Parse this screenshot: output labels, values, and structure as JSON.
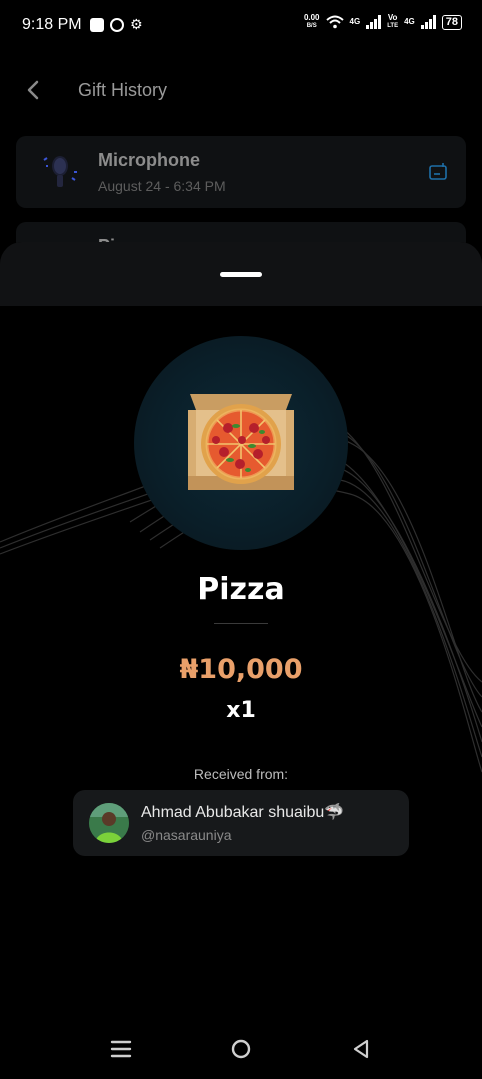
{
  "status_bar": {
    "time": "9:18 PM",
    "net_speed_value": "0.00",
    "net_speed_unit": "B/S",
    "network_1": "4G",
    "volte_top": "Vo",
    "volte_bottom": "LTE",
    "network_2": "4G",
    "battery": "78"
  },
  "header": {
    "title": "Gift History"
  },
  "gift_list": [
    {
      "name": "Microphone",
      "date": "August 24 - 6:34 PM"
    },
    {
      "name": "Pizza",
      "date": ""
    }
  ],
  "sheet": {
    "gift_name": "Pizza",
    "price": "₦10,000",
    "quantity": "x1",
    "received_label": "Received from:",
    "sender": {
      "name": "Ahmad Abubakar shuaibu🦈",
      "handle": "@nasarauniya"
    }
  },
  "colors": {
    "price": "#e9a06a",
    "accent": "#1e6fa8",
    "sheet_header": "#111214"
  }
}
